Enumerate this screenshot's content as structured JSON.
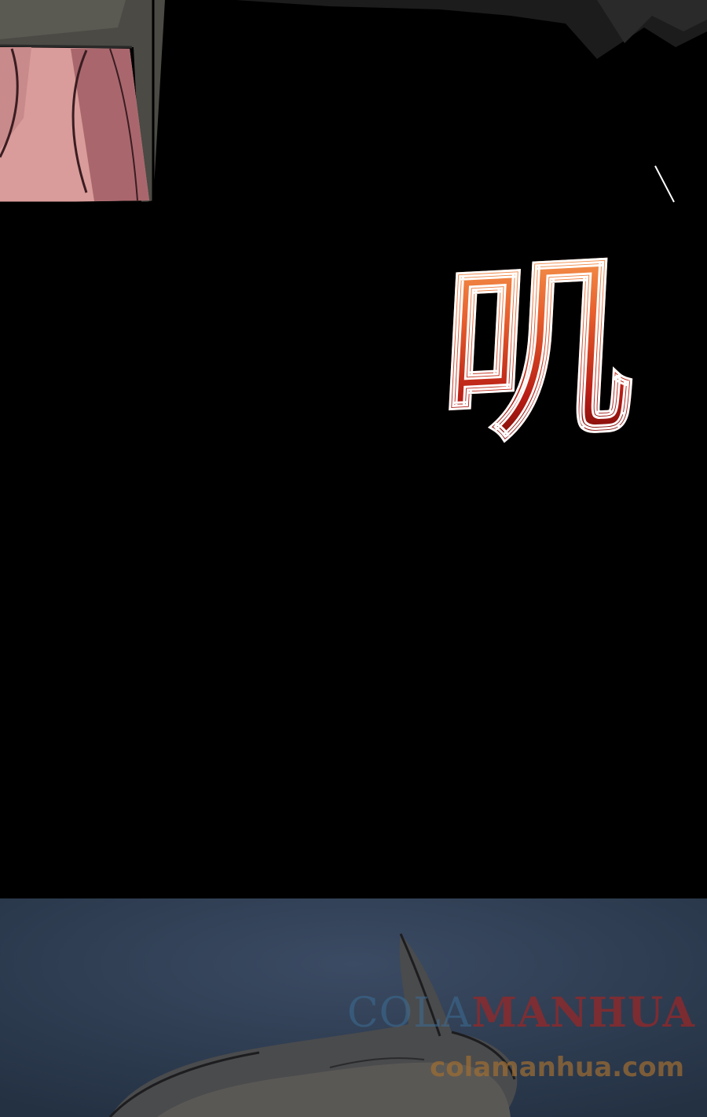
{
  "sound_effect": {
    "text": "叽",
    "colors": {
      "top": "#f7a455",
      "middle": "#e8612e",
      "bottom": "#5a0505",
      "outline": "#ffffff"
    }
  },
  "watermark": {
    "line1_part_a": "COLA",
    "line1_part_b": "MANHUA",
    "line2": "colamanhua.com"
  },
  "colors": {
    "background": "#000000",
    "night_panel": "#2f3d52",
    "skin": "#c77f80",
    "clothing_gray": "#4b4a44"
  }
}
